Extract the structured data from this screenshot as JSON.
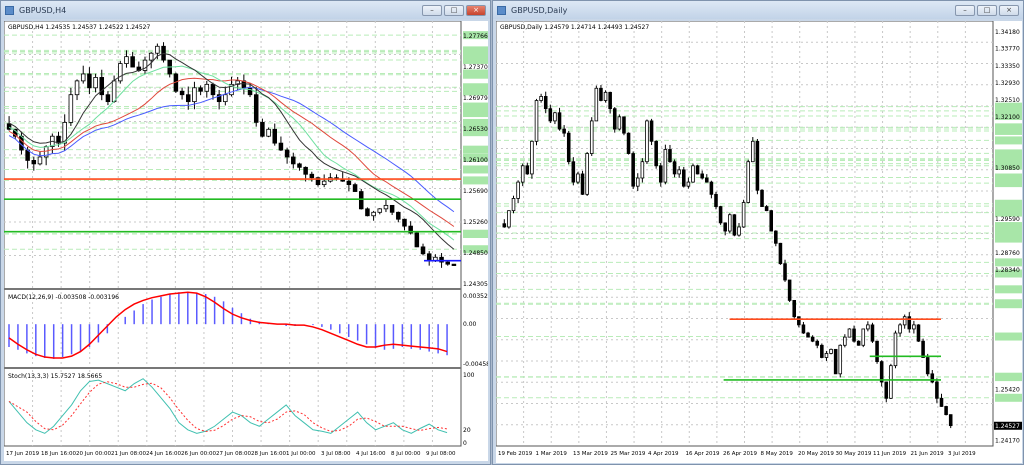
{
  "left": {
    "title": "GBPUSD,H4",
    "header": "GBPUSD,H4  1.24535 1.24537 1.24522 1.24527",
    "price_range": [
      1.2422,
      1.2795
    ],
    "price_labels": [
      "1.27766",
      "1.27370",
      "1.26979",
      "1.26530",
      "1.26100",
      "1.25690",
      "1.25260",
      "1.24850",
      "1.24305"
    ],
    "time_labels": [
      "17 Jun 2019",
      "18 Jun 16:00",
      "20 Jun 00:00",
      "21 Jun 08:00",
      "24 Jun 16:00",
      "26 Jun 00:00",
      "27 Jun 08:00",
      "28 Jun 16:00",
      "1 Jul 00:00",
      "3 Jul 08:00",
      "4 Jul 16:00",
      "8 Jul 00:00",
      "9 Jul 08:00"
    ],
    "closes": [
      1.265,
      1.264,
      1.262,
      1.2605,
      1.26,
      1.261,
      1.2625,
      1.264,
      1.263,
      1.266,
      1.27,
      1.272,
      1.273,
      1.271,
      1.2725,
      1.27,
      1.269,
      1.272,
      1.2745,
      1.2755,
      1.274,
      1.2735,
      1.275,
      1.276,
      1.277,
      1.275,
      1.273,
      1.2705,
      1.27,
      1.269,
      1.271,
      1.2705,
      1.2715,
      1.27,
      1.269,
      1.27,
      1.2715,
      1.272,
      1.271,
      1.27,
      1.266,
      1.264,
      1.265,
      1.263,
      1.262,
      1.261,
      1.26,
      1.2595,
      1.2585,
      1.258,
      1.257,
      1.2575,
      1.258,
      1.2578,
      1.2575,
      1.257,
      1.256,
      1.2535,
      1.2525,
      1.253,
      1.2535,
      1.254,
      1.253,
      1.252,
      1.251,
      1.25,
      1.248,
      1.247,
      1.246,
      1.2465,
      1.2458,
      1.2455,
      1.2453
    ],
    "levels": [
      {
        "price": 1.2578,
        "color": "#ff4a1c"
      },
      {
        "price": 1.2549,
        "color": "#22bb22"
      },
      {
        "price": 1.2502,
        "color": "#22bb22"
      },
      {
        "price": 1.246,
        "color": "#1a1aff"
      }
    ],
    "moving_averages": [
      {
        "period": 30,
        "color": "#4a5cff"
      },
      {
        "period": 20,
        "color": "#e0483c"
      },
      {
        "period": 12,
        "color": "#6fe0a0"
      },
      {
        "period": 8,
        "color": "#333333"
      }
    ],
    "macd": {
      "label": "MACD(12,26,9) -0.003508 -0.003196",
      "max_label": "0.003524",
      "zero_label": "0.00",
      "min_label": "-0.00458",
      "range": [
        -0.00458,
        0.003524
      ],
      "hist": [
        -0.0025,
        -0.0028,
        -0.0032,
        -0.0035,
        -0.0037,
        -0.0038,
        -0.0036,
        -0.0033,
        -0.003,
        -0.0025,
        -0.002,
        -0.001,
        0.0,
        0.0008,
        0.0015,
        0.0022,
        0.0027,
        0.003,
        0.0033,
        0.0035,
        0.0035,
        0.0034,
        0.0033,
        0.003,
        0.0025,
        0.0018,
        0.0012,
        0.0006,
        0.0003,
        0.0001,
        0.0,
        -0.0002,
        -0.0002,
        0.0,
        -0.0001,
        -0.0003,
        -0.0006,
        -0.001,
        -0.0014,
        -0.0018,
        -0.0022,
        -0.0026,
        -0.0028,
        -0.0027,
        -0.0025,
        -0.0027,
        -0.0028,
        -0.003,
        -0.0032,
        -0.0034
      ],
      "signal": [
        -0.0015,
        -0.0022,
        -0.0028,
        -0.0033,
        -0.0036,
        -0.0037,
        -0.0037,
        -0.0035,
        -0.003,
        -0.0022,
        -0.0012,
        -0.0002,
        0.0008,
        0.0016,
        0.0022,
        0.0026,
        0.0029,
        0.0031,
        0.0033,
        0.0034,
        0.0035,
        0.0034,
        0.003,
        0.0024,
        0.0017,
        0.0011,
        0.0007,
        0.0004,
        0.0002,
        0.0001,
        0.0,
        0.0,
        -0.0001,
        -0.0001,
        -0.0003,
        -0.0006,
        -0.001,
        -0.0014,
        -0.0018,
        -0.0022,
        -0.0025,
        -0.0025,
        -0.0023,
        -0.0022,
        -0.0023,
        -0.0024,
        -0.0025,
        -0.0026,
        -0.0027,
        -0.003
      ],
      "hist_color": "#5a5aff",
      "signal_color": "#ff0000"
    },
    "stoch": {
      "label": "Stoch(13,3,3) 15.7527 18.5665",
      "top_label": "100",
      "mid_label": "20",
      "bottom_label": "0",
      "main": [
        60,
        45,
        30,
        20,
        15,
        25,
        40,
        55,
        75,
        88,
        90,
        85,
        80,
        75,
        85,
        92,
        80,
        65,
        50,
        30,
        20,
        15,
        18,
        25,
        35,
        45,
        40,
        30,
        25,
        35,
        45,
        55,
        40,
        30,
        20,
        18,
        15,
        25,
        35,
        45,
        30,
        20,
        25,
        30,
        20,
        15,
        22,
        28,
        20,
        16
      ],
      "main_color": "#40c0b0",
      "signal_color": "#ff3030"
    }
  },
  "right": {
    "title": "GBPUSD,Daily",
    "header": "GBPUSD,Daily  1.24579 1.24714 1.24493 1.24527",
    "price_range": [
      1.2408,
      1.344
    ],
    "price_labels": [
      "1.34180",
      "1.33770",
      "1.33350",
      "1.32930",
      "1.32510",
      "1.32100",
      "1.30850",
      "1.29590",
      "1.28760",
      "1.28340",
      "1.25420",
      "1.24170"
    ],
    "current_price": "1.24527",
    "time_labels": [
      "19 Feb 2019",
      "1 Mar 2019",
      "13 Mar 2019",
      "25 Mar 2019",
      "4 Apr 2019",
      "16 Apr 2019",
      "26 Apr 2019",
      "8 May 2019",
      "20 May 2019",
      "30 May 2019",
      "11 Jun 2019",
      "21 Jun 2019",
      "3 Jul 2019"
    ],
    "closes": [
      1.294,
      1.298,
      1.301,
      1.305,
      1.309,
      1.307,
      1.315,
      1.325,
      1.326,
      1.323,
      1.32,
      1.322,
      1.318,
      1.317,
      1.31,
      1.305,
      1.307,
      1.302,
      1.312,
      1.32,
      1.328,
      1.325,
      1.327,
      1.323,
      1.318,
      1.321,
      1.317,
      1.312,
      1.304,
      1.306,
      1.31,
      1.32,
      1.315,
      1.309,
      1.305,
      1.313,
      1.31,
      1.307,
      1.308,
      1.304,
      1.305,
      1.309,
      1.307,
      1.306,
      1.305,
      1.302,
      1.299,
      1.295,
      1.293,
      1.297,
      1.292,
      1.294,
      1.3,
      1.31,
      1.315,
      1.303,
      1.299,
      1.298,
      1.293,
      1.29,
      1.285,
      1.281,
      1.276,
      1.272,
      1.27,
      1.268,
      1.267,
      1.266,
      1.265,
      1.262,
      1.263,
      1.264,
      1.258,
      1.265,
      1.267,
      1.269,
      1.266,
      1.265,
      1.269,
      1.27,
      1.266,
      1.261,
      1.256,
      1.252,
      1.26,
      1.268,
      1.27,
      1.272,
      1.269,
      1.27,
      1.266,
      1.262,
      1.258,
      1.256,
      1.252,
      1.25,
      1.248,
      1.2453
    ],
    "levels": [
      {
        "price": 1.2714,
        "color": "#ff4a1c",
        "from": 0.61
      },
      {
        "price": 1.2623,
        "color": "#22bb22",
        "from": 0.82
      },
      {
        "price": 1.2565,
        "color": "#22bb22",
        "from": 0.59
      }
    ]
  }
}
